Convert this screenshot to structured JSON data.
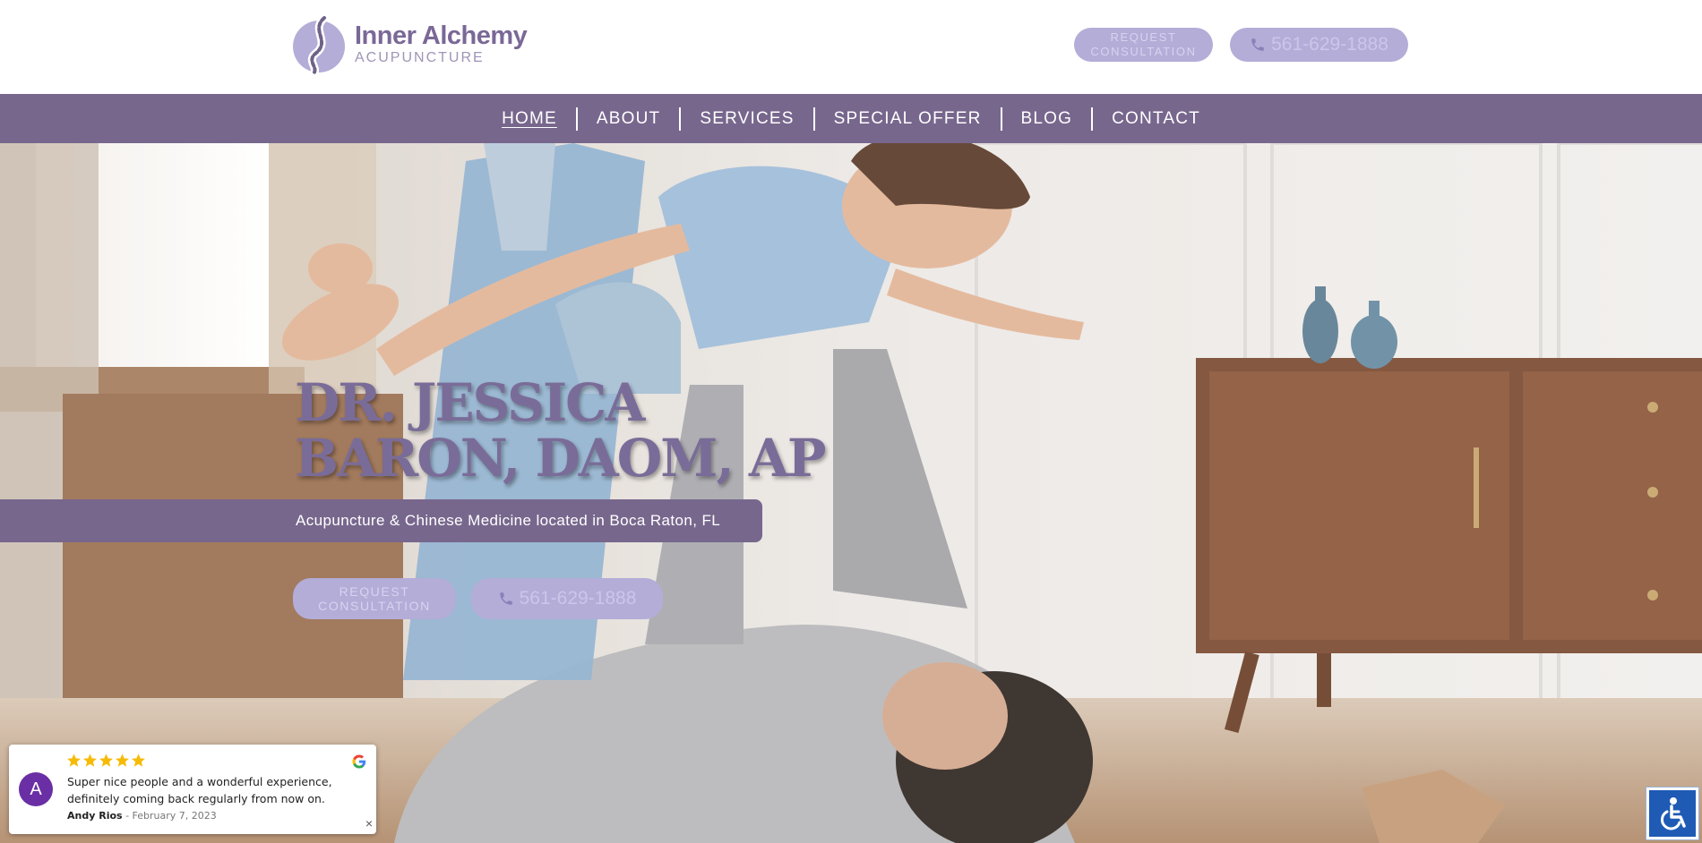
{
  "header": {
    "logo": {
      "name": "Inner Alchemy",
      "subtitle": "ACUPUNCTURE",
      "icon": "spine-logo-icon"
    },
    "request_button": {
      "line1": "REQUEST",
      "line2": "CONSULTATION"
    },
    "phone_button": {
      "icon": "phone-icon",
      "label": "561-629-1888"
    }
  },
  "nav": {
    "items": [
      {
        "label": "HOME",
        "active": true
      },
      {
        "label": "ABOUT"
      },
      {
        "label": "SERVICES"
      },
      {
        "label": "SPECIAL OFFER"
      },
      {
        "label": "BLOG"
      },
      {
        "label": "CONTACT"
      }
    ]
  },
  "hero": {
    "title_line1": "DR. JESSICA",
    "title_line2": "BARON, DAOM, AP",
    "tagline": "Acupuncture & Chinese Medicine located in Boca Raton, FL",
    "request_button": {
      "line1": "REQUEST",
      "line2": "CONSULTATION"
    },
    "phone_button": {
      "icon": "phone-icon",
      "label": "561-629-1888"
    }
  },
  "review": {
    "avatar_letter": "A",
    "rating": 5,
    "text_line1": "Super nice people and a wonderful experience,",
    "text_line2": "definitely coming back regularly from now on.",
    "author": "Andy Rios",
    "date": " - February 7, 2023",
    "source_icon": "google-g-icon",
    "close": "×"
  },
  "accessibility": {
    "icon": "wheelchair-icon"
  },
  "colors": {
    "brand_purple": "#77678d",
    "button_lavender": "#b3add8",
    "star_gold": "#f6bb06",
    "avatar_purple": "#6a2fa4",
    "a11y_blue": "#1f5bb5"
  }
}
